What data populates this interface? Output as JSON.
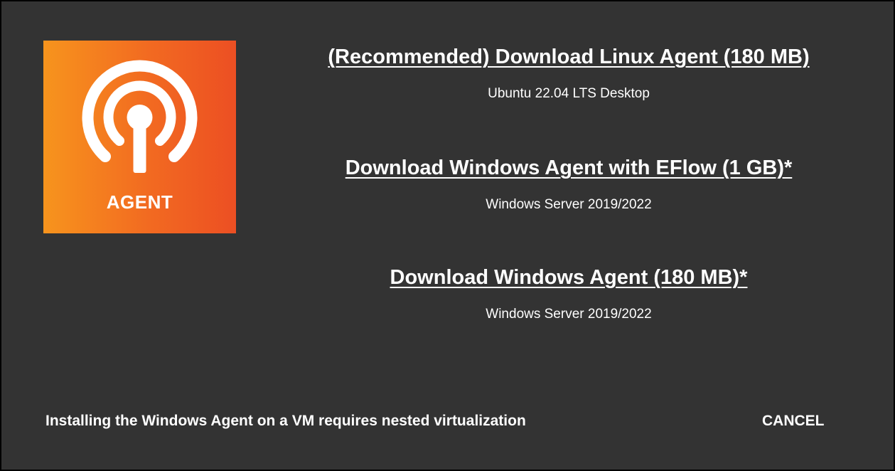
{
  "logo": {
    "icon": "broadcast-antenna-icon",
    "label": "AGENT",
    "gradient_start": "#f7941d",
    "gradient_end": "#ec4f23"
  },
  "options": [
    {
      "link": "(Recommended) Download Linux Agent (180 MB)",
      "subtitle": "Ubuntu 22.04 LTS Desktop"
    },
    {
      "link": "Download Windows Agent with EFlow (1 GB)*",
      "subtitle": "Windows Server 2019/2022"
    },
    {
      "link": "Download Windows Agent (180 MB)*",
      "subtitle": "Windows Server 2019/2022"
    }
  ],
  "footer": {
    "note": "Installing the Windows Agent on a VM requires nested virtualization",
    "cancel_label": "CANCEL"
  },
  "colors": {
    "background": "#333333",
    "text": "#ffffff"
  }
}
